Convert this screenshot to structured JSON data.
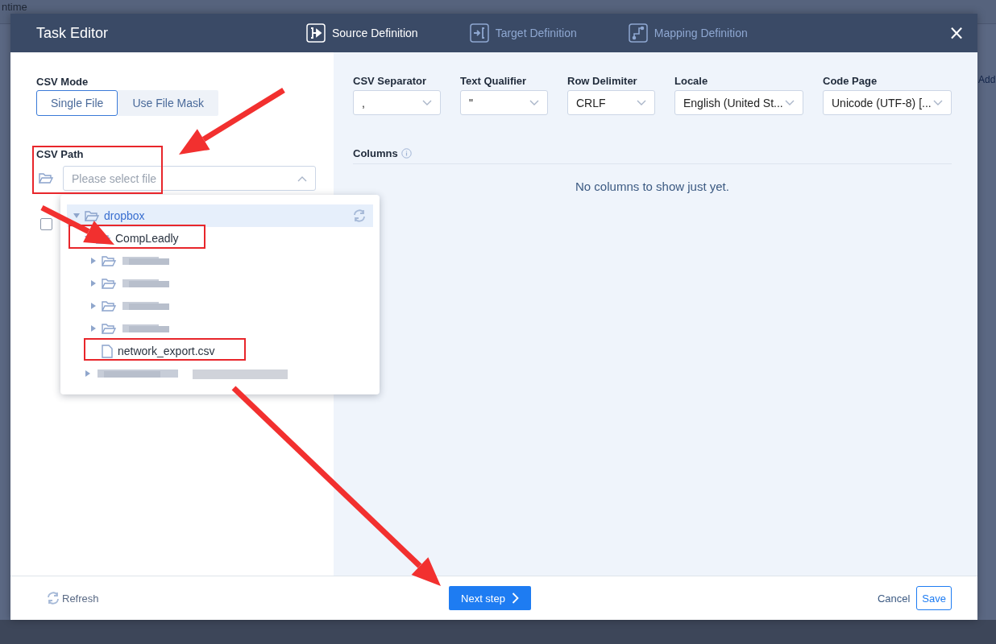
{
  "background": {
    "texts": [
      "ntime",
      "Add"
    ]
  },
  "dialog": {
    "title": "Task Editor",
    "steps": [
      {
        "label": "Source Definition",
        "kind": "source",
        "selected": true
      },
      {
        "label": "Target Definition",
        "kind": "target",
        "selected": false
      },
      {
        "label": "Mapping Definition",
        "kind": "mapping",
        "selected": false
      }
    ],
    "close": "×"
  },
  "csv_mode": {
    "label": "CSV Mode",
    "options": [
      {
        "label": "Single File",
        "selected": true
      },
      {
        "label": "Use File Mask",
        "selected": false
      }
    ]
  },
  "csv_path": {
    "label": "CSV Path",
    "placeholder": "Please select file",
    "open": true
  },
  "checkbox": {
    "checked": false
  },
  "file_tree": {
    "items": [
      {
        "kind": "folder",
        "label": "dropbox",
        "selected": true,
        "expanded": true,
        "children": [
          {
            "kind": "folder",
            "label": "CompLeadly",
            "selected": false,
            "expanded": true,
            "children": [
              {
                "kind": "folder",
                "redacted": true,
                "expanded": false
              },
              {
                "kind": "folder",
                "redacted": true,
                "expanded": false
              },
              {
                "kind": "folder",
                "redacted": true,
                "expanded": false
              },
              {
                "kind": "folder",
                "redacted": true,
                "expanded": false
              },
              {
                "kind": "file",
                "label": "network_export.csv",
                "selected": false
              }
            ]
          },
          {
            "kind": "item",
            "redacted": true,
            "expanded": false
          }
        ]
      }
    ]
  },
  "settings": [
    {
      "label": "CSV Separator",
      "value": ","
    },
    {
      "label": "Text Qualifier",
      "value": "\""
    },
    {
      "label": "Row Delimiter",
      "value": "CRLF"
    },
    {
      "label": "Locale",
      "value": "English (United St..."
    },
    {
      "label": "Code Page",
      "value": "Unicode (UTF-8) [..."
    }
  ],
  "columns": {
    "label": "Columns",
    "empty_text": "No columns to show just yet."
  },
  "footer": {
    "refresh": "Refresh",
    "next": "Next step",
    "cancel": "Cancel",
    "save": "Save"
  }
}
